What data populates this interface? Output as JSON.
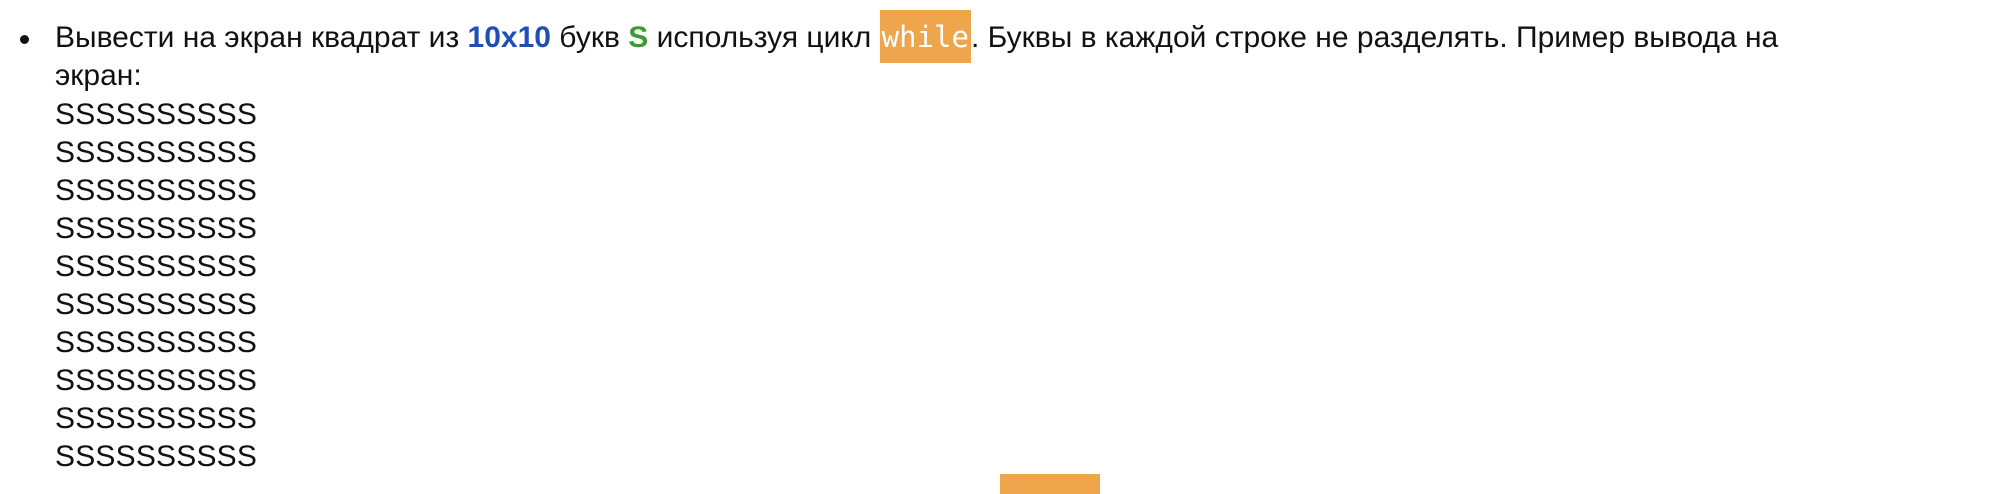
{
  "task": {
    "text_before_size": "Вывести на экран квадрат из ",
    "size": "10x10",
    "text_before_letter": " букв ",
    "letter": "S",
    "text_before_keyword": " используя цикл ",
    "keyword": "while",
    "text_after_keyword": ". Буквы в каждой строке не разделять. Пример вывода на",
    "text_line2": "экран:"
  },
  "output_example": {
    "lines": [
      "SSSSSSSSSS",
      "SSSSSSSSSS",
      "SSSSSSSSSS",
      "SSSSSSSSSS",
      "SSSSSSSSSS",
      "SSSSSSSSSS",
      "SSSSSSSSSS",
      "SSSSSSSSSS",
      "SSSSSSSSSS",
      "SSSSSSSSSS"
    ]
  },
  "colors": {
    "size_highlight": "#1f4fb4",
    "letter_highlight": "#3c9a30",
    "keyword_background": "#efa54c",
    "keyword_text": "#ffffff"
  }
}
